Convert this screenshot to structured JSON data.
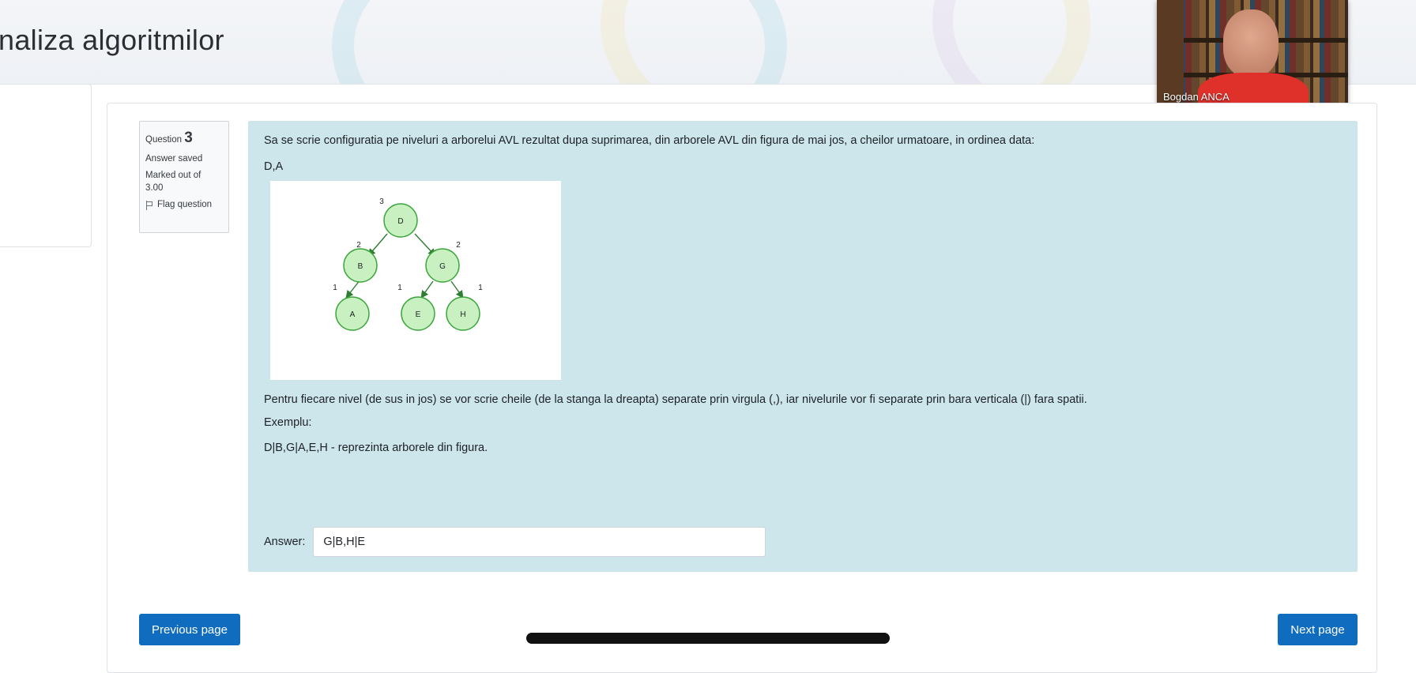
{
  "header": {
    "title": "naliza algoritmilor"
  },
  "video": {
    "participant_name": "Bogdan ANCA"
  },
  "question_info": {
    "label": "Question",
    "number": "3",
    "status": "Answer saved",
    "marked": "Marked out of",
    "max_grade": "3.00",
    "flag_label": "Flag question"
  },
  "question": {
    "text": "Sa se scrie configuratia pe niveluri a arborelui AVL rezultat dupa suprimarea, din arborele AVL din figura de mai jos, a cheilor urmatoare, in ordinea data:",
    "keys": "D,A",
    "instructions": "Pentru fiecare nivel (de sus in jos) se vor scrie cheile (de la stanga la dreapta) separate prin virgula (,), iar nivelurile vor fi separate prin bara verticala (|) fara spatii.",
    "example_label": "Exemplu:",
    "example": "D|B,G|A,E,H - reprezinta arborele din figura.",
    "answer_label": "Answer:",
    "answer_value": "G|B,H|E"
  },
  "tree": {
    "nodes": [
      {
        "key": "D",
        "height": "3"
      },
      {
        "key": "B",
        "height": "2"
      },
      {
        "key": "G",
        "height": "2"
      },
      {
        "key": "A",
        "height": "1"
      },
      {
        "key": "E",
        "height": "1"
      },
      {
        "key": "H",
        "height": "1"
      }
    ],
    "colors": {
      "fill": "#c8f0c0",
      "stroke": "#3aa53a",
      "edge": "#2e7d32"
    }
  },
  "navigation": {
    "prev_label": "Previous page",
    "next_label": "Next page"
  }
}
